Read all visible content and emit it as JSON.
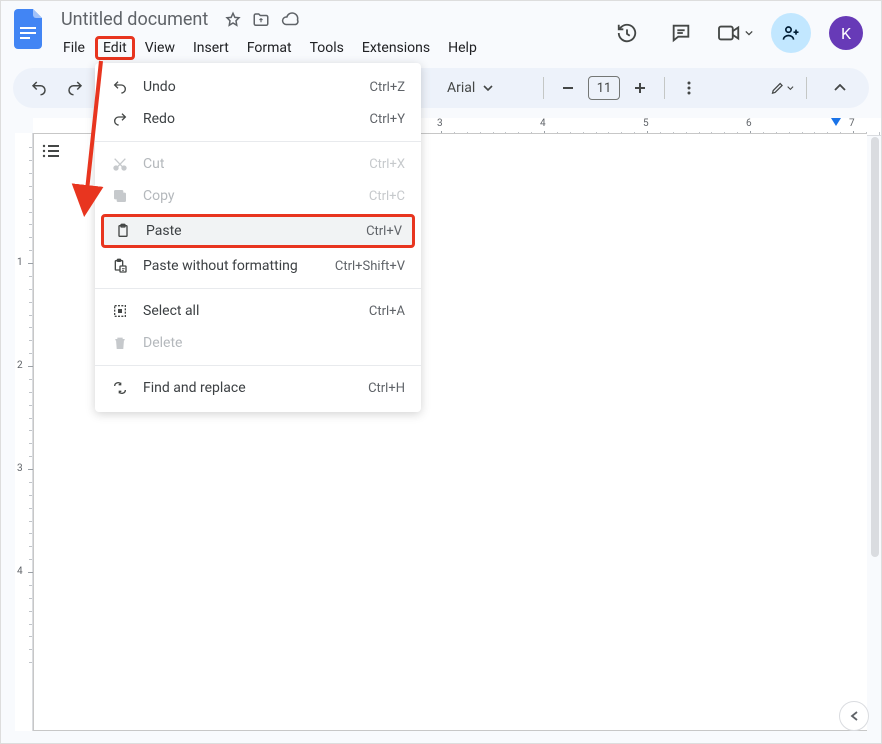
{
  "doc": {
    "title": "Untitled document"
  },
  "menubar": {
    "file": "File",
    "edit": "Edit",
    "view": "View",
    "insert": "Insert",
    "format": "Format",
    "tools": "Tools",
    "extensions": "Extensions",
    "help": "Help"
  },
  "toolbar": {
    "font_name": "Arial",
    "font_size": "11"
  },
  "header": {
    "avatar_initial": "K"
  },
  "edit_menu": {
    "undo": {
      "label": "Undo",
      "shortcut": "Ctrl+Z"
    },
    "redo": {
      "label": "Redo",
      "shortcut": "Ctrl+Y"
    },
    "cut": {
      "label": "Cut",
      "shortcut": "Ctrl+X"
    },
    "copy": {
      "label": "Copy",
      "shortcut": "Ctrl+C"
    },
    "paste": {
      "label": "Paste",
      "shortcut": "Ctrl+V"
    },
    "paste_plain": {
      "label": "Paste without formatting",
      "shortcut": "Ctrl+Shift+V"
    },
    "select_all": {
      "label": "Select all",
      "shortcut": "Ctrl+A"
    },
    "delete": {
      "label": "Delete",
      "shortcut": ""
    },
    "find_replace": {
      "label": "Find and replace",
      "shortcut": "Ctrl+H"
    }
  },
  "ruler_h": {
    "labels": [
      "3",
      "4",
      "5",
      "6",
      "7"
    ]
  },
  "ruler_v": {
    "labels": [
      "1",
      "2",
      "3",
      "4"
    ]
  }
}
